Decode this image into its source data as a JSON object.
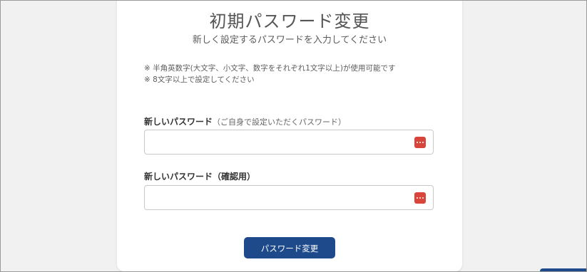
{
  "page": {
    "title": "初期パスワード変更",
    "subtitle": "新しく設定するパスワードを入力してください"
  },
  "notes": [
    "※ 半角英数字(大文字、小文字、数字をそれぞれ1文字以上)が使用可能です",
    "※ 8文字以上で設定してください"
  ],
  "fields": {
    "new_password": {
      "label": "新しいパスワード",
      "hint": "（ご自身で設定いただくパスワード）",
      "value": "",
      "placeholder": ""
    },
    "confirm_password": {
      "label": "新しいパスワード（確認用）",
      "value": "",
      "placeholder": ""
    }
  },
  "submit_label": "パスワード変更",
  "icons": {
    "password_manager": "password-key-icon"
  },
  "colors": {
    "background": "#f1f1f1",
    "card": "#ffffff",
    "primary": "#1e4a8c",
    "icon_red": "#d9453b"
  }
}
